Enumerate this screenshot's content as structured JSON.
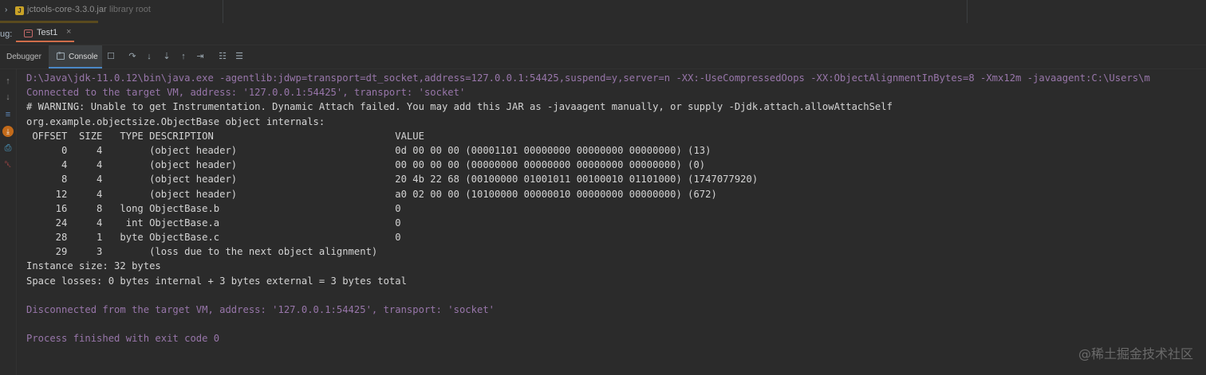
{
  "top_strip": {
    "expand_glyph": "›",
    "jar_name": "jctools-core-3.3.0.jar",
    "jar_sub": "library root"
  },
  "run_bar": {
    "debug_label": "ug:",
    "tab_label": "Test1",
    "tab_close": "×"
  },
  "tool_bar": {
    "debugger_label": "Debugger",
    "console_label": "Console",
    "buttons": [
      "layout-icon",
      "step-over-icon",
      "step-into-icon",
      "force-step-into-icon",
      "step-out-icon",
      "run-to-cursor-icon",
      "evaluate-icon",
      "trace-icon"
    ]
  },
  "gutter": {
    "buttons": [
      "up-arrow-icon",
      "down-arrow-icon",
      "soft-wrap-icon",
      "scroll-to-end-icon",
      "print-icon",
      "clear-icon"
    ]
  },
  "console": {
    "lines": [
      {
        "text": "D:\\Java\\jdk-11.0.12\\bin\\java.exe -agentlib:jdwp=transport=dt_socket,address=127.0.0.1:54425,suspend=y,server=n -XX:-UseCompressedOops -XX:ObjectAlignmentInBytes=8 -Xmx12m -javaagent:C:\\Users\\m",
        "color": "purple"
      },
      {
        "text": "Connected to the target VM, address: '127.0.0.1:54425', transport: 'socket'",
        "color": "purple"
      },
      {
        "text": "# WARNING: Unable to get Instrumentation. Dynamic Attach failed. You may add this JAR as -javaagent manually, or supply -Djdk.attach.allowAttachSelf",
        "color": "white"
      },
      {
        "text": "org.example.objectsize.ObjectBase object internals:",
        "color": "white"
      },
      {
        "text": " OFFSET  SIZE   TYPE DESCRIPTION                               VALUE",
        "color": "white"
      },
      {
        "text": "      0     4        (object header)                           0d 00 00 00 (00001101 00000000 00000000 00000000) (13)",
        "color": "white"
      },
      {
        "text": "      4     4        (object header)                           00 00 00 00 (00000000 00000000 00000000 00000000) (0)",
        "color": "white"
      },
      {
        "text": "      8     4        (object header)                           20 4b 22 68 (00100000 01001011 00100010 01101000) (1747077920)",
        "color": "white"
      },
      {
        "text": "     12     4        (object header)                           a0 02 00 00 (10100000 00000010 00000000 00000000) (672)",
        "color": "white"
      },
      {
        "text": "     16     8   long ObjectBase.b                              0",
        "color": "white"
      },
      {
        "text": "     24     4    int ObjectBase.a                              0",
        "color": "white"
      },
      {
        "text": "     28     1   byte ObjectBase.c                              0",
        "color": "white"
      },
      {
        "text": "     29     3        (loss due to the next object alignment)",
        "color": "white"
      },
      {
        "text": "Instance size: 32 bytes",
        "color": "white"
      },
      {
        "text": "Space losses: 0 bytes internal + 3 bytes external = 3 bytes total",
        "color": "white"
      },
      {
        "text": "",
        "color": "white"
      },
      {
        "text": "Disconnected from the target VM, address: '127.0.0.1:54425', transport: 'socket'",
        "color": "purple"
      },
      {
        "text": "",
        "color": "white"
      },
      {
        "text": "Process finished with exit code 0",
        "color": "purple"
      }
    ]
  },
  "watermark": "@稀土掘金技术社区",
  "colors": {
    "background": "#2b2b2b",
    "purple_text": "#9876aa",
    "white_text": "#d4d4d4",
    "console_tab_underline": "#4a88c7",
    "run_tab_underline": "#d06d4a"
  }
}
